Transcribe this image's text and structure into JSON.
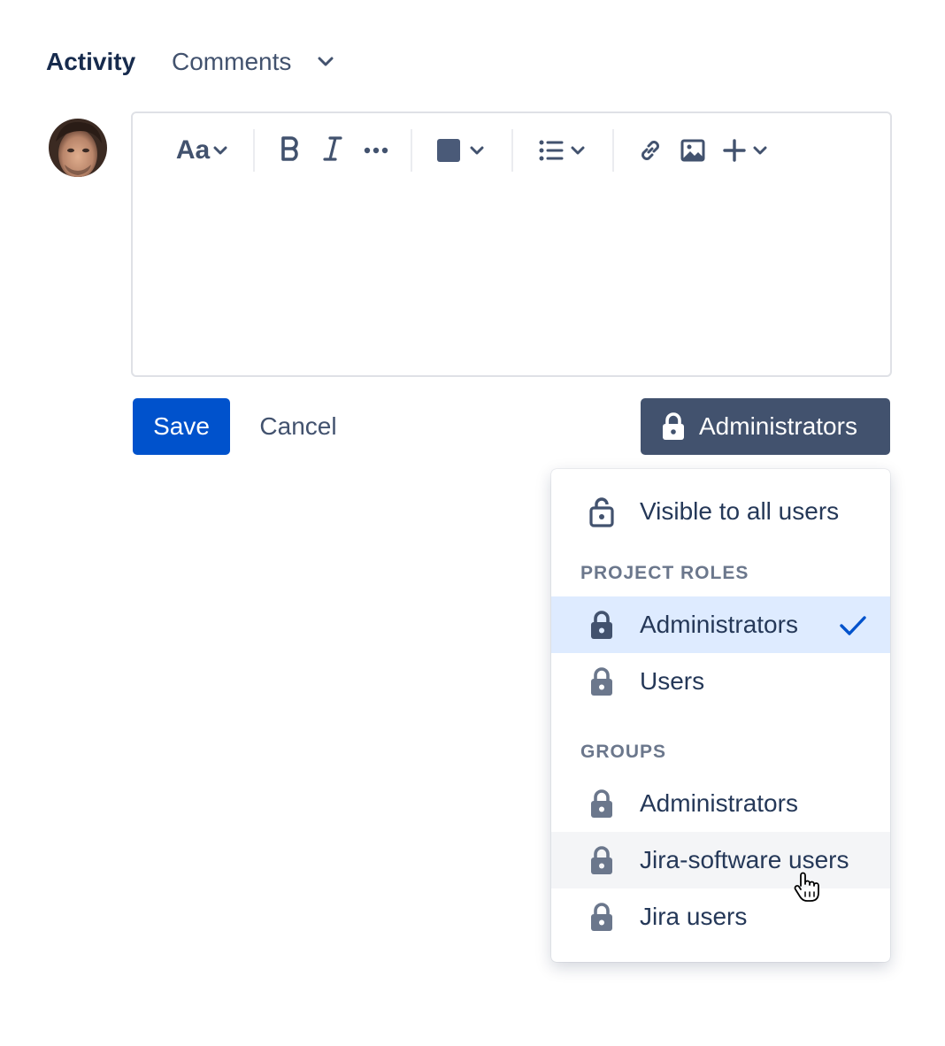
{
  "header": {
    "title": "Activity",
    "filter": {
      "selected": "Comments"
    }
  },
  "editor": {
    "toolbar": {
      "text_style_label": "Aa",
      "items": [
        "text-style",
        "bold",
        "italic",
        "more-formatting",
        "text-color",
        "lists",
        "link",
        "image",
        "insert"
      ]
    },
    "content": ""
  },
  "actions": {
    "save_label": "Save",
    "cancel_label": "Cancel",
    "visibility_label": "Administrators"
  },
  "visibility_menu": {
    "all_users_label": "Visible to all users",
    "project_roles_heading": "PROJECT ROLES",
    "project_roles": [
      {
        "label": "Administrators",
        "selected": true
      },
      {
        "label": "Users",
        "selected": false
      }
    ],
    "groups_heading": "GROUPS",
    "groups": [
      {
        "label": "Administrators",
        "hovered": false
      },
      {
        "label": "Jira-software users",
        "hovered": true
      },
      {
        "label": "Jira users",
        "hovered": false
      }
    ]
  },
  "colors": {
    "primary": "#0052CC",
    "neutral_button": "#42526E",
    "selected_bg": "#DEEBFF",
    "hover_bg": "#F4F5F7",
    "text": "#172B4D",
    "heading_gray": "#6B778C"
  }
}
